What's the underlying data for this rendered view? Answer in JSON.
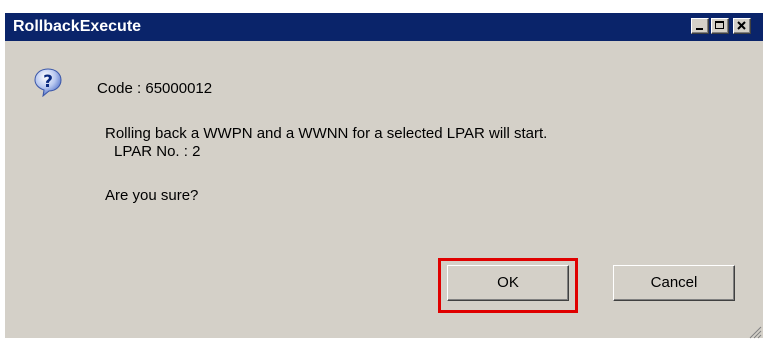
{
  "window": {
    "title": "RollbackExecute",
    "controls": {
      "minimize": "minimize",
      "maximize": "maximize",
      "close": "close"
    }
  },
  "message": {
    "icon": "question-icon",
    "code": "Code : 65000012",
    "line1": "Rolling back a WWPN and a WWNN for a selected LPAR will start.",
    "line2": "LPAR No. : 2",
    "line3": "Are you sure?"
  },
  "buttons": {
    "ok_label": "OK",
    "cancel_label": "Cancel"
  },
  "colors": {
    "titlebar": "#0a246a",
    "dialog_bg": "#d4d0c8",
    "highlight": "#e00000"
  }
}
